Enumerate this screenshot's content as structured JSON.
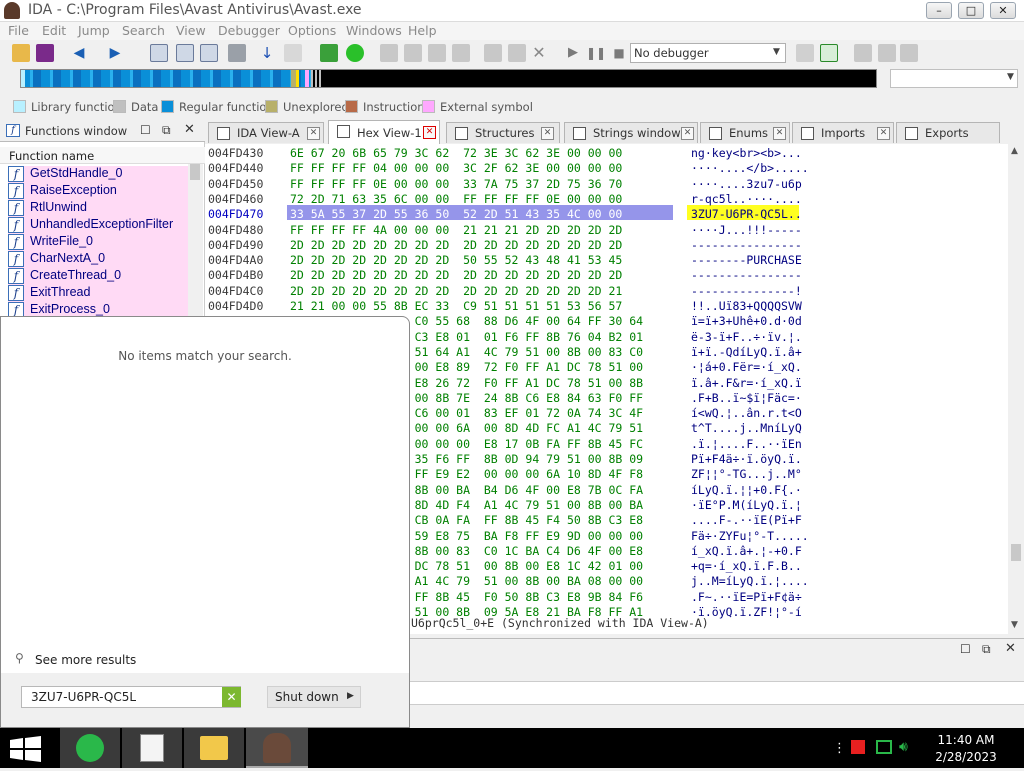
{
  "window": {
    "title": "IDA - C:\\Program Files\\Avast Antivirus\\Avast.exe",
    "minimize_glyph": "–",
    "maximize_glyph": "□",
    "close_glyph": "✕"
  },
  "menu": [
    "File",
    "Edit",
    "Jump",
    "Search",
    "View",
    "Debugger",
    "Options",
    "Windows",
    "Help"
  ],
  "toolbar": {
    "debugger_select": "No debugger"
  },
  "legend": [
    {
      "label": "Library function",
      "color": "#b8f0ff"
    },
    {
      "label": "Data",
      "color": "#c0c0c0"
    },
    {
      "label": "Regular function",
      "color": "#0a8fd8"
    },
    {
      "label": "Unexplored",
      "color": "#b8b06a"
    },
    {
      "label": "Instruction",
      "color": "#b86a48"
    },
    {
      "label": "External symbol",
      "color": "#ffa8ff"
    }
  ],
  "functions_window": {
    "title": "Functions window",
    "column": "Function name",
    "items": [
      "GetStdHandle_0",
      "RaiseException",
      "RtlUnwind",
      "UnhandledExceptionFilter",
      "WriteFile_0",
      "CharNextA_0",
      "CreateThread_0",
      "ExitThread",
      "ExitProcess_0"
    ]
  },
  "tabs": [
    "IDA View-A",
    "Hex View-1",
    "Structures",
    "Strings window",
    "Enums",
    "Imports",
    "Exports"
  ],
  "active_tab": "Hex View-1",
  "hex": {
    "rows": [
      {
        "addr": "004FD430",
        "bytes": "6E 67 20 6B 65 79 3C 62  72 3E 3C 62 3E 00 00 00",
        "ascii": "ng·key<br><b>..."
      },
      {
        "addr": "004FD440",
        "bytes": "FF FF FF FF 04 00 00 00  3C 2F 62 3E 00 00 00 00",
        "ascii": "····....</b>....."
      },
      {
        "addr": "004FD450",
        "bytes": "FF FF FF FF 0E 00 00 00  33 7A 75 37 2D 75 36 70",
        "ascii": "····....3zu7-u6p"
      },
      {
        "addr": "004FD460",
        "bytes": "72 2D 71 63 35 6C 00 00  FF FF FF FF 0E 00 00 00",
        "ascii": "r-qc5l..····...."
      },
      {
        "addr": "004FD470",
        "bytes": "33 5A 55 37 2D 55 36 50  52 2D 51 43 35 4C 00 00",
        "ascii": "3ZU7-U6PR-QC5L.."
      },
      {
        "addr": "004FD480",
        "bytes": "FF FF FF FF 4A 00 00 00  21 21 21 2D 2D 2D 2D 2D",
        "ascii": "····J...!!!-----"
      },
      {
        "addr": "004FD490",
        "bytes": "2D 2D 2D 2D 2D 2D 2D 2D  2D 2D 2D 2D 2D 2D 2D 2D",
        "ascii": "----------------"
      },
      {
        "addr": "004FD4A0",
        "bytes": "2D 2D 2D 2D 2D 2D 2D 2D  50 55 52 43 48 41 53 45",
        "ascii": "--------PURCHASE"
      },
      {
        "addr": "004FD4B0",
        "bytes": "2D 2D 2D 2D 2D 2D 2D 2D  2D 2D 2D 2D 2D 2D 2D 2D",
        "ascii": "----------------"
      },
      {
        "addr": "004FD4C0",
        "bytes": "2D 2D 2D 2D 2D 2D 2D 2D  2D 2D 2D 2D 2D 2D 2D 21",
        "ascii": "---------------!"
      },
      {
        "addr": "004FD4D0",
        "bytes": "21 21 00 00 55 8B EC 33  C9 51 51 51 51 53 56 57",
        "ascii": "!!..Uï83+QQQQSVW"
      },
      {
        "addr": "",
        "bytes": "                  C0 55 68  88 D6 4F 00 64 FF 30 64",
        "ascii": "ï=ï+3+Uhê+0.d·0d"
      },
      {
        "addr": "",
        "bytes": "                  C3 E8 01  01 F6 FF 8B 76 04 B2 01",
        "ascii": "ë-3-ï+F..÷·ïv.¦."
      },
      {
        "addr": "",
        "bytes": "                  51 64 A1  4C 79 51 00 8B 00 83 C0",
        "ascii": "ï+ï.-QdíLyQ.ï.â+"
      },
      {
        "addr": "",
        "bytes": "                  00 E8 89  72 F0 FF A1 DC 78 51 00",
        "ascii": "·¦á+0.Fër=·í_xQ."
      },
      {
        "addr": "",
        "bytes": "                  E8 26 72  F0 FF A1 DC 78 51 00 8B",
        "ascii": "ï.â+.F&r=·í_xQ.ï"
      },
      {
        "addr": "",
        "bytes": "                  00 8B 7E  24 8B C6 E8 84 63 F0 FF",
        "ascii": ".F+B..ï~$ï¦Fäc=·"
      },
      {
        "addr": "",
        "bytes": "                  C6 00 01  83 EF 01 72 0A 74 3C 4F",
        "ascii": "í<wQ.¦..ân.r.t<O"
      },
      {
        "addr": "",
        "bytes": "                  00 00 6A  00 8D 4D FC A1 4C 79 51",
        "ascii": "t^T....j..MníLyQ"
      },
      {
        "addr": "",
        "bytes": "                  00 00 00  E8 17 0B FA FF 8B 45 FC",
        "ascii": ".ï.¦....F..··ïEn"
      },
      {
        "addr": "",
        "bytes": "                  35 F6 FF  8B 0D 94 79 51 00 8B 09",
        "ascii": "Pï+F4ä÷·ï.öyQ.ï."
      },
      {
        "addr": "",
        "bytes": "                  FF E9 E2  00 00 00 6A 10 8D 4F F8",
        "ascii": "ZF¦¦°-TG...j..M°"
      },
      {
        "addr": "",
        "bytes": "                  8B 00 BA  B4 D6 4F 00 E8 7B 0C FA",
        "ascii": "íLyQ.ï.¦¦+0.F{.·"
      },
      {
        "addr": "",
        "bytes": "                  8D 4D F4  A1 4C 79 51 00 8B 00 BA",
        "ascii": "·ïE°P.M(íLyQ.ï.¦"
      },
      {
        "addr": "",
        "bytes": "                  CB 0A FA  FF 8B 45 F4 50 8B C3 E8",
        "ascii": "....F-.··ïE(Pï+F"
      },
      {
        "addr": "",
        "bytes": "                  59 E8 75  BA F8 FF E9 9D 00 00 00",
        "ascii": "Fä÷·ZYFu¦°-T....."
      },
      {
        "addr": "",
        "bytes": "                  8B 00 83  C0 1C BA C4 D6 4F 00 E8",
        "ascii": "í_xQ.ï.â+.¦-+0.F"
      },
      {
        "addr": "",
        "bytes": "                  DC 78 51  00 8B 00 E8 1C 42 01 00",
        "ascii": "+q=·í_xQ.ï.F.B.."
      },
      {
        "addr": "",
        "bytes": "                  A1 4C 79  51 00 8B 00 BA 08 00 00",
        "ascii": "j..M=íLyQ.ï.¦...."
      },
      {
        "addr": "",
        "bytes": "                  FF 8B 45  F0 50 8B C3 E8 9B 84 F6",
        "ascii": ".F~.··ïE=Pï+F¢ä÷"
      },
      {
        "addr": "",
        "bytes": "                  51 00 8B  09 5A E8 21 BA F8 FF A1",
        "ascii": "·ï.öyQ.ï.ZF!¦°-í"
      }
    ],
    "status": "U6prQc5l_0+E (Synchronized with IDA View-A)",
    "selected_row": "004FD470",
    "selected_bytes": "33 5A 55 37 2D 55 36 50  52 2D 51 43 35 4C",
    "selected_ascii": "3ZU7-U6PR-QC5L"
  },
  "search": {
    "no_results": "No items match your search.",
    "see_more": "See more results",
    "query": "3ZU7-U6PR-QC5L",
    "shutdown": "Shut down"
  },
  "taskbar": {
    "time": "11:40 AM",
    "date": "2/28/2023"
  }
}
